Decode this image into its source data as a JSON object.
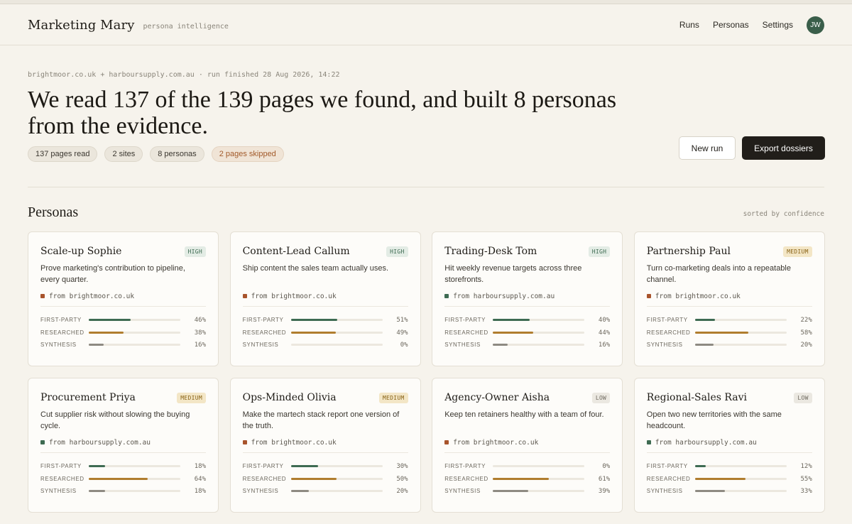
{
  "app": {
    "title": "Marketing Mary",
    "subtitle": "persona intelligence",
    "nav": [
      "Runs",
      "Personas",
      "Settings"
    ],
    "avatar_initials": "JW"
  },
  "run": {
    "meta": "brightmoor.co.uk + harboursupply.com.au · run finished 28 Aug 2026, 14:22",
    "headline": "We read 137 of the 139 pages we found, and built 8 personas from the evidence.",
    "pills": [
      "137 pages read",
      "2 sites",
      "8 personas",
      "2 pages skipped"
    ],
    "new_run_label": "New run",
    "export_label": "Export dossiers"
  },
  "personas_section": {
    "title": "Personas",
    "sort_note": "sorted by confidence",
    "metric_labels": [
      "FIRST-PARTY",
      "RESEARCHED",
      "SYNTHESIS"
    ],
    "cards": [
      {
        "name": "Scale-up Sophie",
        "confidence": "HIGH",
        "desc": "Prove marketing's contribution to pipeline, every quarter.",
        "source": "from brightmoor.co.uk",
        "source_color": "orange",
        "first_party": 46,
        "researched": 38,
        "synthesis": 16
      },
      {
        "name": "Content-Lead Callum",
        "confidence": "HIGH",
        "desc": "Ship content the sales team actually uses.",
        "source": "from brightmoor.co.uk",
        "source_color": "orange",
        "first_party": 51,
        "researched": 49,
        "synthesis": 0
      },
      {
        "name": "Trading-Desk Tom",
        "confidence": "HIGH",
        "desc": "Hit weekly revenue targets across three storefronts.",
        "source": "from harboursupply.com.au",
        "source_color": "green",
        "first_party": 40,
        "researched": 44,
        "synthesis": 16
      },
      {
        "name": "Partnership Paul",
        "confidence": "MEDIUM",
        "desc": "Turn co-marketing deals into a repeatable channel.",
        "source": "from brightmoor.co.uk",
        "source_color": "orange",
        "first_party": 22,
        "researched": 58,
        "synthesis": 20
      },
      {
        "name": "Procurement Priya",
        "confidence": "MEDIUM",
        "desc": "Cut supplier risk without slowing the buying cycle.",
        "source": "from harboursupply.com.au",
        "source_color": "green",
        "first_party": 18,
        "researched": 64,
        "synthesis": 18
      },
      {
        "name": "Ops-Minded Olivia",
        "confidence": "MEDIUM",
        "desc": "Make the martech stack report one version of the truth.",
        "source": "from brightmoor.co.uk",
        "source_color": "orange",
        "first_party": 30,
        "researched": 50,
        "synthesis": 20
      },
      {
        "name": "Agency-Owner Aisha",
        "confidence": "LOW",
        "desc": "Keep ten retainers healthy with a team of four.",
        "source": "from brightmoor.co.uk",
        "source_color": "orange",
        "first_party": 0,
        "researched": 61,
        "synthesis": 39
      },
      {
        "name": "Regional-Sales Ravi",
        "confidence": "LOW",
        "desc": "Open two new territories with the same headcount.",
        "source": "from harboursupply.com.au",
        "source_color": "green",
        "first_party": 12,
        "researched": 55,
        "synthesis": 33
      }
    ]
  }
}
